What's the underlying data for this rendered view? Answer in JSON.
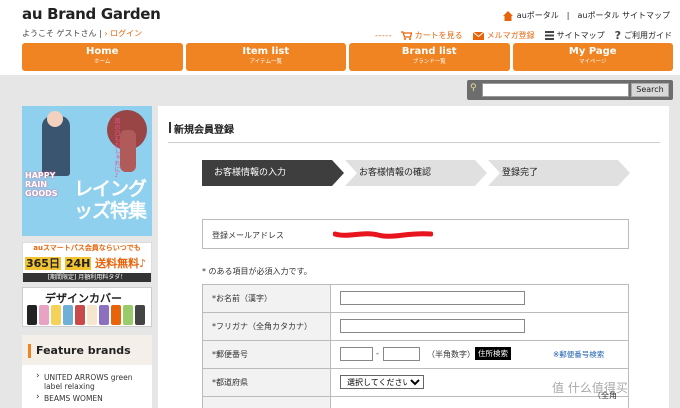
{
  "header": {
    "logo": "au Brand Garden",
    "welcome_prefix": "ようこそ ゲストさん",
    "separator": "|",
    "login": "ログイン",
    "au_portal": "auポータル",
    "divider": "|",
    "sitemap_portal": "auポータル サイトマップ",
    "cart": "カートを見る",
    "magazine": "メルマガ登録",
    "sitemap": "サイトマップ",
    "guide": "ご利用ガイド"
  },
  "nav": [
    {
      "en": "Home",
      "jp": "ホーム"
    },
    {
      "en": "Item list",
      "jp": "アイテム一覧"
    },
    {
      "en": "Brand list",
      "jp": "ブランド一覧"
    },
    {
      "en": "My Page",
      "jp": "マイページ"
    }
  ],
  "search": {
    "button": "Search",
    "value": ""
  },
  "ads": {
    "rain_happy": "HAPPY RAIN GOODS",
    "rain_title": "レイングッズ特集",
    "rain_sub": "雨の日もおしゃれに♪",
    "pass_line1": "auスマートパス会員ならいつでも",
    "pass_365": "365日",
    "pass_24h": "24H",
    "pass_free": "送料無料♪",
    "pass_line3": "[期間限定] 月額利用料タダ！",
    "cover_title": "デザインカバー"
  },
  "feature": {
    "title": "Feature brands",
    "items": [
      "UNITED ARROWS green label relaxing",
      "BEAMS WOMEN"
    ]
  },
  "main": {
    "title": "新規会員登録",
    "steps": [
      "お客様情報の入力",
      "お客様情報の確認",
      "登録完了"
    ],
    "email_label": "登録メールアドレス",
    "required_note": "* のある項目が必須入力です。",
    "fields": {
      "name": "*お名前（漢字）",
      "furigana": "*フリガナ（全角カタカナ）",
      "zip": "*郵便番号",
      "zip_dash": "-",
      "zip_hint": "（半角数字）",
      "zip_search": "住所検索",
      "zip_link": "※郵便番号検索",
      "pref": "*都道府県",
      "pref_select": "選択してください",
      "kana_note": "（全角"
    }
  },
  "colors": {
    "accent": "#f08322",
    "step_active": "#3e3e3e"
  },
  "watermark": "值 什么值得买"
}
